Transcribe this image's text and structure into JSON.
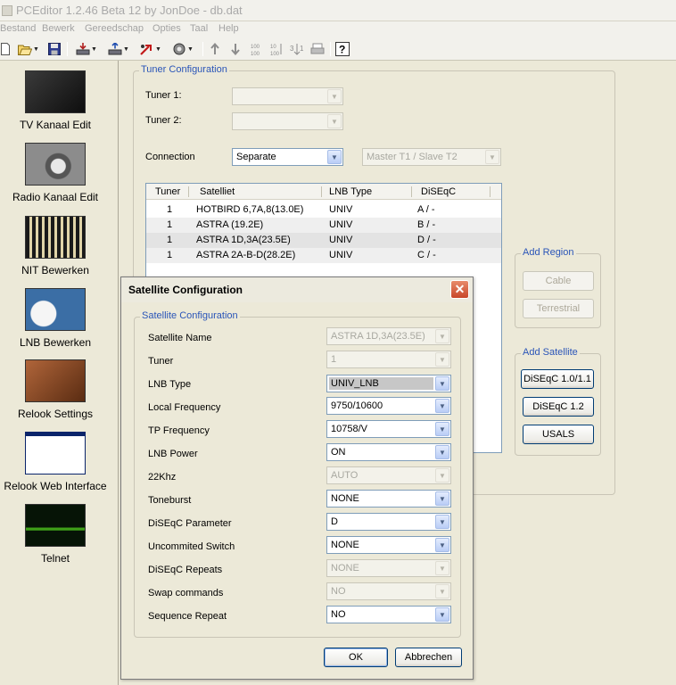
{
  "window": {
    "title": "PCEditor 1.2.46 Beta 12 by JonDoe - db.dat"
  },
  "menu": [
    "Bestand",
    "Bewerk",
    "Gereedschap",
    "Opties",
    "Taal",
    "Help"
  ],
  "toolbar": {
    "icons": [
      "new-icon",
      "open-icon",
      "save-icon",
      "receiver-download-icon",
      "receiver-upload-icon",
      "transfer-icon",
      "tools-icon",
      "move-up-icon",
      "move-down-icon",
      "renumber-icon",
      "sort-icon",
      "sort-alt-icon",
      "print-icon",
      "help-icon"
    ],
    "renumber_text": "100\n100",
    "help_glyph": "?"
  },
  "sidebar": {
    "items": [
      {
        "label": "TV Kanaal Edit",
        "color": "#1c1c1c"
      },
      {
        "label": "Radio Kanaal Edit",
        "color": "#6a6a6a"
      },
      {
        "label": "NIT Bewerken",
        "color": "#b5a370"
      },
      {
        "label": "LNB Bewerken",
        "color": "#3b6ea5"
      },
      {
        "label": "Relook Settings",
        "color": "#8a4a26"
      },
      {
        "label": "Relook Web Interface",
        "color": "#ffffff"
      },
      {
        "label": "Telnet",
        "color": "#0f2a0a"
      }
    ]
  },
  "tuner_config": {
    "title": "Tuner Configuration",
    "tuner1_label": "Tuner 1:",
    "tuner1_value": "",
    "tuner2_label": "Tuner 2:",
    "tuner2_value": "",
    "connection_label": "Connection",
    "connection_value": "Separate",
    "master_slave_value": "Master T1 / Slave T2",
    "columns": [
      "Tuner",
      "Satelliet",
      "LNB Type",
      "DiSEqC"
    ],
    "rows": [
      {
        "tuner": "1",
        "satellite": "HOTBIRD 6,7A,8(13.0E)",
        "lnb": "UNIV",
        "diseqc": "A / -"
      },
      {
        "tuner": "1",
        "satellite": "ASTRA (19.2E)",
        "lnb": "UNIV",
        "diseqc": "B / -"
      },
      {
        "tuner": "1",
        "satellite": "ASTRA 1D,3A(23.5E)",
        "lnb": "UNIV",
        "diseqc": "D / -"
      },
      {
        "tuner": "1",
        "satellite": "ASTRA 2A-B-D(28.2E)",
        "lnb": "UNIV",
        "diseqc": "C / -"
      }
    ]
  },
  "add_region": {
    "title": "Add Region",
    "cable": "Cable",
    "terrestrial": "Terrestrial"
  },
  "add_satellite": {
    "title": "Add Satellite",
    "diseqc10": "DiSEqC 1.0/1.1",
    "diseqc12": "DiSEqC 1.2",
    "usals": "USALS"
  },
  "dialog": {
    "title": "Satellite Configuration",
    "close_glyph": "✕",
    "group_title": "Satellite Configuration",
    "fields": [
      {
        "label": "Satellite Name",
        "value": "ASTRA 1D,3A(23.5E)",
        "enabled": false
      },
      {
        "label": "Tuner",
        "value": "1",
        "enabled": false
      },
      {
        "label": "LNB Type",
        "value": "UNIV_LNB",
        "enabled": true
      },
      {
        "label": "Local Frequency",
        "value": "9750/10600",
        "enabled": true
      },
      {
        "label": "TP Frequency",
        "value": "10758/V",
        "enabled": true
      },
      {
        "label": "LNB Power",
        "value": "ON",
        "enabled": true
      },
      {
        "label": "22Khz",
        "value": "AUTO",
        "enabled": false
      },
      {
        "label": "Toneburst",
        "value": "NONE",
        "enabled": true
      },
      {
        "label": "DiSEqC Parameter",
        "value": "D",
        "enabled": true
      },
      {
        "label": "Uncommited Switch",
        "value": "NONE",
        "enabled": true
      },
      {
        "label": "DiSEqC Repeats",
        "value": "NONE",
        "enabled": false
      },
      {
        "label": "Swap commands",
        "value": "NO",
        "enabled": false
      },
      {
        "label": "Sequence Repeat",
        "value": "NO",
        "enabled": true
      }
    ],
    "ok": "OK",
    "cancel": "Abbrechen"
  }
}
